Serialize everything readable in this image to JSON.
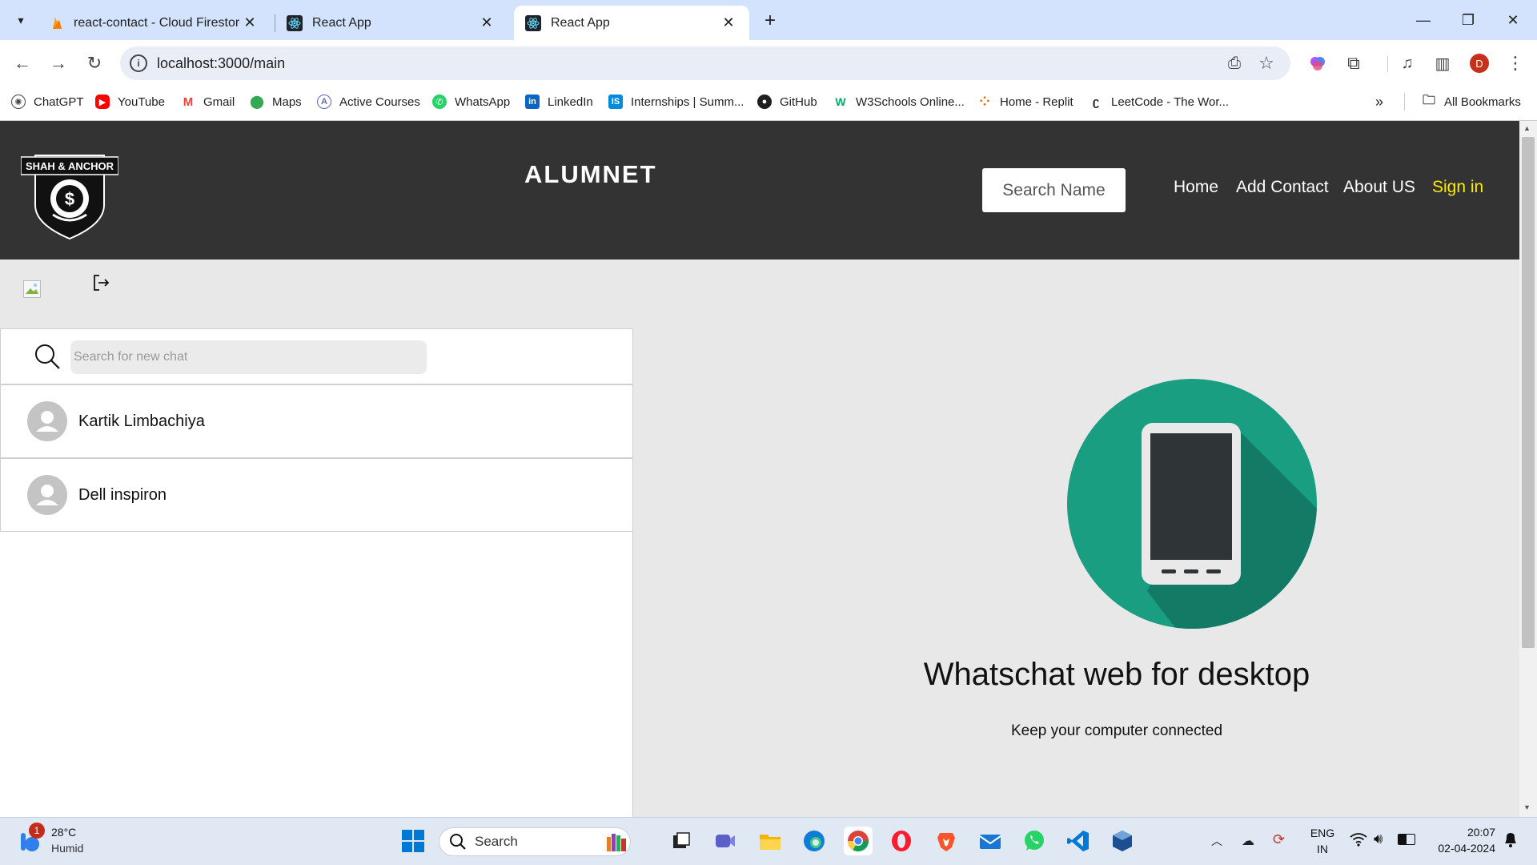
{
  "browser": {
    "tabs": [
      {
        "title": "react-contact - Cloud Firestore",
        "active": false
      },
      {
        "title": "React App",
        "active": false
      },
      {
        "title": "React App",
        "active": true
      }
    ],
    "new_tab_label": "+",
    "url": "localhost:3000/main",
    "profile_initial": "D",
    "bookmarks": [
      {
        "label": "ChatGPT",
        "icon": "chatgpt-icon"
      },
      {
        "label": "YouTube",
        "icon": "youtube-icon"
      },
      {
        "label": "Gmail",
        "icon": "gmail-icon"
      },
      {
        "label": "Maps",
        "icon": "maps-icon"
      },
      {
        "label": "Active Courses",
        "icon": "courses-icon"
      },
      {
        "label": "WhatsApp",
        "icon": "whatsapp-icon"
      },
      {
        "label": "LinkedIn",
        "icon": "linkedin-icon"
      },
      {
        "label": "Internships | Summ...",
        "icon": "internshala-icon"
      },
      {
        "label": "GitHub",
        "icon": "github-icon"
      },
      {
        "label": "W3Schools Online...",
        "icon": "w3schools-icon"
      },
      {
        "label": "Home - Replit",
        "icon": "replit-icon"
      },
      {
        "label": "LeetCode - The Wor...",
        "icon": "leetcode-icon"
      }
    ],
    "all_bookmarks": "All Bookmarks"
  },
  "app": {
    "logo_text": "SHAH & ANCHOR",
    "brand": "ALUMNET",
    "search_placeholder": "Search Name",
    "nav": [
      "Home",
      "Add Contact",
      "About US",
      "Sign in"
    ],
    "chat_search_placeholder": "Search for new chat",
    "chats": [
      "Kartik Limbachiya",
      "Dell inspiron"
    ],
    "welcome_title": "Whatschat web for desktop",
    "welcome_subtitle": "Keep your computer connected"
  },
  "colors": {
    "header_bg": "#333333",
    "sign_in": "#ffea00",
    "phone_circle": "#1a9e82",
    "phone_shadow": "#137a66"
  },
  "taskbar": {
    "weather_temp": "28°C",
    "weather_desc": "Humid",
    "weather_badge": "1",
    "search_label": "Search",
    "lang": "ENG",
    "region": "IN",
    "time": "20:07",
    "date": "02-04-2024"
  }
}
